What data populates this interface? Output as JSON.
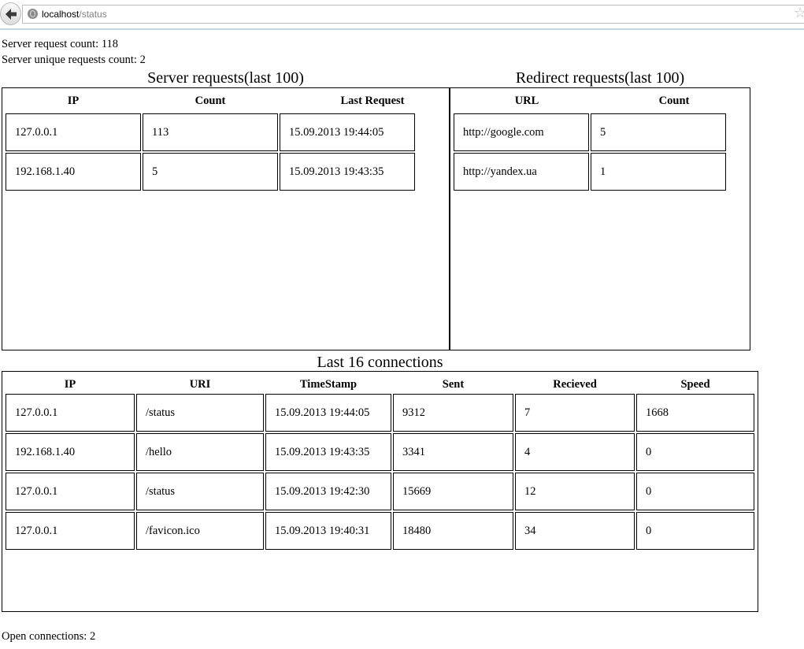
{
  "browser": {
    "url_host": "localhost",
    "url_path": "/status"
  },
  "summary": {
    "request_count": "Server request count: 118",
    "unique_count": "Server unique requests count: 2"
  },
  "server_requests": {
    "title": "Server requests(last 100)",
    "headers": [
      "IP",
      "Count",
      "Last Request"
    ],
    "rows": [
      [
        "127.0.0.1",
        "113",
        "15.09.2013 19:44:05"
      ],
      [
        "192.168.1.40",
        "5",
        "15.09.2013 19:43:35"
      ]
    ]
  },
  "redirect_requests": {
    "title": "Redirect requests(last 100)",
    "headers": [
      "URL",
      "Count"
    ],
    "rows": [
      [
        "http://google.com",
        "5"
      ],
      [
        "http://yandex.ua",
        "1"
      ]
    ]
  },
  "connections": {
    "title": "Last 16 connections",
    "headers": [
      "IP",
      "URI",
      "TimeStamp",
      "Sent",
      "Recieved",
      "Speed"
    ],
    "rows": [
      [
        "127.0.0.1",
        "/status",
        "15.09.2013 19:44:05",
        "9312",
        "7",
        "1668"
      ],
      [
        "192.168.1.40",
        "/hello",
        "15.09.2013 19:43:35",
        "3341",
        "4",
        "0"
      ],
      [
        "127.0.0.1",
        "/status",
        "15.09.2013 19:42:30",
        "15669",
        "12",
        "0"
      ],
      [
        "127.0.0.1",
        "/favicon.ico",
        "15.09.2013 19:40:31",
        "18480",
        "34",
        "0"
      ]
    ]
  },
  "footer": {
    "open_connections": "Open connections: 2"
  }
}
